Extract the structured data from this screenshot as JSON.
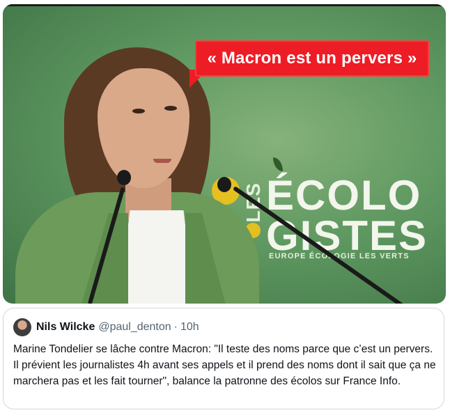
{
  "media": {
    "bubble_text": "« Macron est un pervers »",
    "logo": {
      "les": "LES",
      "line1": "ÉCOLO",
      "line2": "GISTES",
      "subtitle": "EUROPE ÉCOLOGIE LES VERTS"
    }
  },
  "quote_tweet": {
    "author_name": "Nils Wilcke",
    "author_handle": "@paul_denton",
    "separator": "·",
    "time": "10h",
    "text": "Marine Tondelier se lâche contre Macron: \"Il teste des noms parce que c’est un pervers. Il prévient les journalistes 4h avant ses appels et il prend des noms dont il sait que ça ne marchera pas et les fait tourner\", balance la patronne des écolos sur France Info."
  },
  "colors": {
    "bubble": "#ee1c25",
    "background_green": "#5f9861",
    "text_primary": "#0f1419",
    "text_secondary": "#536471",
    "border": "#cfd9de"
  }
}
